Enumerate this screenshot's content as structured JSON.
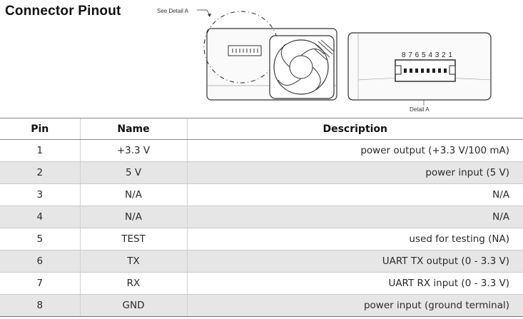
{
  "title": "Connector Pinout",
  "figure": {
    "detail_callout": "See Detail A",
    "detail_caption": "Detail A",
    "pin_numbers": "8 7 6 5 4 3 2 1"
  },
  "table": {
    "headers": {
      "pin": "Pin",
      "name": "Name",
      "description": "Description"
    },
    "rows": [
      {
        "pin": "1",
        "name": "+3.3 V",
        "description": "power output (+3.3 V/100 mA)"
      },
      {
        "pin": "2",
        "name": "5 V",
        "description": "power input (5 V)"
      },
      {
        "pin": "3",
        "name": "N/A",
        "description": "N/A"
      },
      {
        "pin": "4",
        "name": "N/A",
        "description": "N/A"
      },
      {
        "pin": "5",
        "name": "TEST",
        "description": "used for testing (NA)"
      },
      {
        "pin": "6",
        "name": "TX",
        "description": "UART TX output (0 - 3.3 V)"
      },
      {
        "pin": "7",
        "name": "RX",
        "description": "UART RX input (0 - 3.3 V)"
      },
      {
        "pin": "8",
        "name": "GND",
        "description": "power input (ground terminal)"
      }
    ]
  }
}
